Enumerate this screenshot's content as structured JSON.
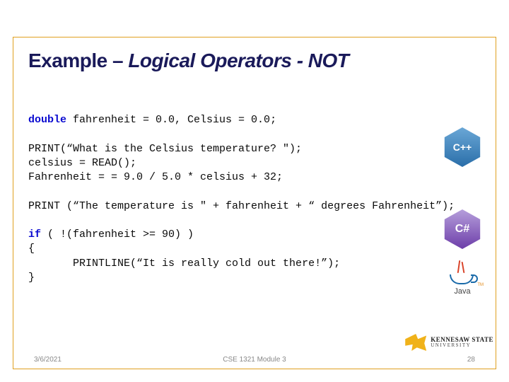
{
  "title": {
    "prefix": "Example – ",
    "italic": "Logical Operators - NOT"
  },
  "code": {
    "kw_double": "double",
    "line1_rest": " fahrenheit = 0.0, Celsius = 0.0;",
    "line3": "PRINT(“What is the Celsius temperature? \");",
    "line4": "celsius = READ();",
    "line5": "Fahrenheit = = 9.0 / 5.0 * celsius + 32;",
    "line7": "PRINT (“The temperature is \" + fahrenheit + “ degrees Fahrenheit”);",
    "kw_if": "if",
    "line9_rest": " ( !(fahrenheit >= 90) )",
    "line10": "{",
    "line11": "       PRINTLINE(“It is really cold out there!”);",
    "line12": "}"
  },
  "logos": {
    "cpp": "C++",
    "csharp": "C#",
    "java": "Java",
    "ksu_line1": "KENNESAW STATE",
    "ksu_line2": "UNIVERSITY"
  },
  "footer": {
    "date": "3/6/2021",
    "module": "CSE 1321 Module 3",
    "page": "28"
  }
}
